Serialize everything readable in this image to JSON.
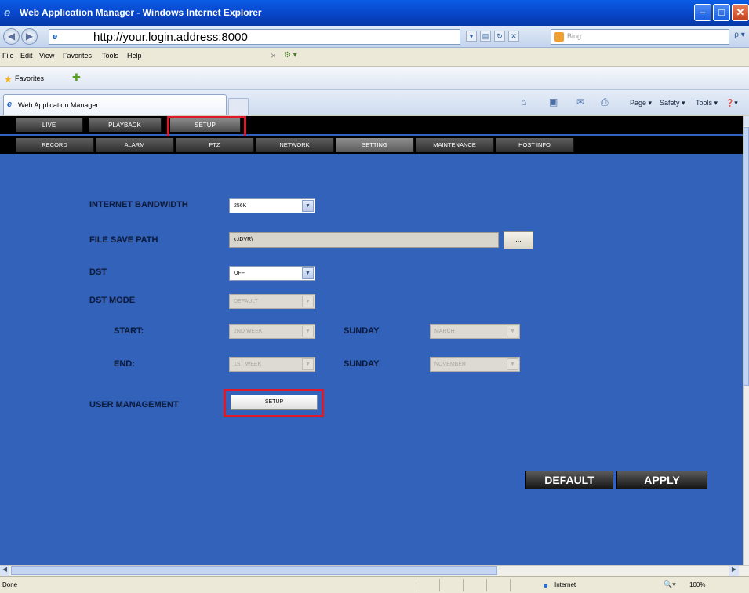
{
  "window": {
    "title": "Web Application Manager - Windows Internet Explorer",
    "min": "–",
    "max": "□",
    "close": "✕"
  },
  "addressbar": {
    "url": "http://your.login.address:8000",
    "search_placeholder": "Bing",
    "back": "◀",
    "forward": "▶",
    "go": "ρ ▾"
  },
  "menubar": {
    "items": [
      "File",
      "Edit",
      "View",
      "Favorites",
      "Tools",
      "Help"
    ],
    "x": "×",
    "ext": "⚙ ▾"
  },
  "favorites": {
    "label": "Favorites"
  },
  "tabbar": {
    "tab_title": "Web Application Manager",
    "page": "Page ▾",
    "safety": "Safety ▾",
    "tools": "Tools ▾",
    "help": "❓▾"
  },
  "dvr": {
    "main_tabs": {
      "live": "LIVE",
      "playback": "PLAYBACK",
      "setup": "SETUP"
    },
    "sub_tabs": {
      "record": "RECORD",
      "alarm": "ALARM",
      "ptz": "PTZ",
      "network": "NETWORK",
      "setting": "SETTING",
      "maintenance": "MAINTENANCE",
      "host_info": "HOST INFO"
    },
    "form": {
      "bandwidth_label": "INTERNET BANDWIDTH",
      "bandwidth_value": "256K",
      "path_label": "FILE SAVE PATH",
      "path_value": "c:\\DVR\\",
      "browse": "...",
      "dst_label": "DST",
      "dst_value": "OFF",
      "dst_mode_label": "DST MODE",
      "dst_mode_value": "DEFAULT",
      "start_label": "START:",
      "start_week": "2ND WEEK",
      "start_day": "SUNDAY",
      "start_month": "MARCH",
      "end_label": "END:",
      "end_week": "1ST WEEK",
      "end_day": "SUNDAY",
      "end_month": "NOVEMBER",
      "user_mgmt_label": "USER MANAGEMENT",
      "user_mgmt_button": "SETUP"
    },
    "buttons": {
      "default": "DEFAULT",
      "apply": "APPLY"
    }
  },
  "statusbar": {
    "status": "Done",
    "zone": "Internet",
    "zoom": "100%"
  }
}
